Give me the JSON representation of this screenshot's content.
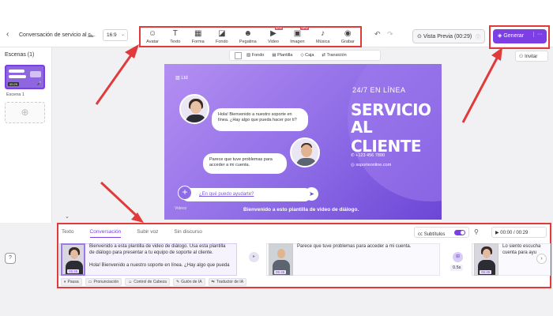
{
  "header": {
    "back_icon": "chevron-left-icon",
    "document_title": "Conversación de servicio al c...",
    "aspect_ratio": "16:9",
    "toolbar_items": [
      {
        "label": "Avatar",
        "icon": "avatar-icon",
        "glyph": "☺",
        "is_new": false
      },
      {
        "label": "Texto",
        "icon": "text-icon",
        "glyph": "T",
        "is_new": false
      },
      {
        "label": "Forma",
        "icon": "shapes-icon",
        "glyph": "▦",
        "is_new": false
      },
      {
        "label": "Fondo",
        "icon": "background-icon",
        "glyph": "◪",
        "is_new": false
      },
      {
        "label": "Pegatina",
        "icon": "sticker-icon",
        "glyph": "☻",
        "is_new": false
      },
      {
        "label": "Video",
        "icon": "video-icon",
        "glyph": "▶",
        "is_new": true
      },
      {
        "label": "Imagen",
        "icon": "image-icon",
        "glyph": "▣",
        "is_new": true
      },
      {
        "label": "Música",
        "icon": "music-icon",
        "glyph": "♪",
        "is_new": false
      },
      {
        "label": "Grabar",
        "icon": "microphone-icon",
        "glyph": "◉",
        "is_new": false
      }
    ],
    "new_badge": "NEW",
    "undo_icon": "undo-icon",
    "redo_icon": "redo-icon",
    "preview_label": "Vista Previa (00:29)",
    "generate_label": "Generar",
    "invite_label": "Invitar"
  },
  "sidebar": {
    "title": "Escenas (1)",
    "scene_label": "Escena 1",
    "scene_time": "00:29"
  },
  "canvas_tools": [
    "Fondo",
    "Plantilla",
    "Caja",
    "Transición"
  ],
  "stage": {
    "brand": "Ltd",
    "bubble1": "Hola! Bienvenido a nuestro soporte en línea. ¿Hay algo que pueda hacer por ti?",
    "bubble2": "Parece que tuve problemas para acceder a mi cuenta.",
    "input_placeholder": "¿En qué puedo ayudarte?",
    "tagline": "24/7 EN LÍNEA",
    "headline1": "SERVICIO",
    "headline2": "AL CLIENTE",
    "phone": "+123 456 7890",
    "website": "soporteonline.com",
    "footer": "Bienvenido a esto plantilla de video de diálogo.",
    "watermark": "Videoz"
  },
  "panel": {
    "tabs": [
      "Texto",
      "Conversación",
      "Subir voz",
      "Sin discurso"
    ],
    "active_tab": "Conversación",
    "subtitles_label": "Subtítulos",
    "player_time": "00:00 / 00:29",
    "clips": [
      {
        "time": "05:45",
        "text": "Bienvenido a esta plantilla de video de diálogo. Usa esta plantilla de diálogo para presentar a tu equipo de soporte al cliente.",
        "text2": "Hola! Bienvenido a nuestro soporte en línea. ¿Hay algo que pueda"
      },
      {
        "time": "05:45",
        "text": "Parece que tuve problemas para acceder a mi cuenta."
      },
      {
        "time": "05:45",
        "text": "Lo siento escucha cuenta para ayu"
      }
    ],
    "pause_value": "0.5s",
    "chips": [
      "Pausa",
      "Pronunciación",
      "Control de Cabeza",
      "Guión de IA",
      "Traductor de IA"
    ]
  }
}
